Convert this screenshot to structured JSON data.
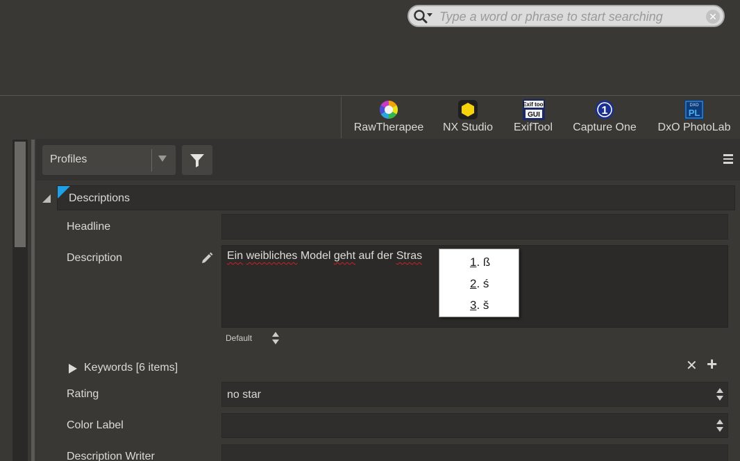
{
  "search": {
    "placeholder": "Type a word or phrase to start searching"
  },
  "tools": [
    {
      "label": "RawTherapee",
      "icon": "rawtherapee-icon"
    },
    {
      "label": "NX Studio",
      "icon": "nx-studio-icon"
    },
    {
      "label": "ExifTool",
      "icon": "exiftool-gui-icon",
      "icon_text_top": "Exif tool",
      "icon_text_bottom": "GUI"
    },
    {
      "label": "Capture One",
      "icon": "capture-one-icon",
      "icon_text": "1"
    },
    {
      "label": "DxO PhotoLab",
      "icon": "dxo-photolab-icon",
      "icon_text_top": "DXO",
      "icon_text_bottom": "PL"
    }
  ],
  "panel": {
    "profiles_value": "Profiles",
    "section_title": "Descriptions",
    "fields": {
      "headline_label": "Headline",
      "description_label": "Description",
      "description_value_words": [
        "Ein",
        "weibliches",
        "Model",
        "geht",
        "auf",
        "der",
        "Stras"
      ],
      "language_value": "Default",
      "keywords_label": "Keywords [6 items]",
      "rating_label": "Rating",
      "rating_value": "no star",
      "color_label_label": "Color Label",
      "color_label_value": "",
      "description_writer_label": "Description Writer"
    }
  },
  "spell_popup": {
    "suggestions": [
      {
        "num": "1",
        "text": "ß"
      },
      {
        "num": "2",
        "text": "ś"
      },
      {
        "num": "3",
        "text": "š"
      }
    ]
  },
  "colors": {
    "accent": "#1ea0e6",
    "background": "#3a3835",
    "field": "#2f2e2c",
    "misspelling": "#d02020"
  }
}
